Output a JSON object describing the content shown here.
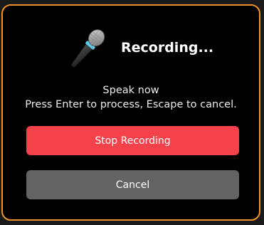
{
  "dialog": {
    "title": "Recording...",
    "icon": "microphone-icon",
    "message_line1": "Speak now",
    "message_line2": "Press Enter to process, Escape to cancel.",
    "stop_label": "Stop Recording",
    "cancel_label": "Cancel"
  },
  "colors": {
    "accent_border": "#f0922c",
    "stop_button": "#f5424a",
    "cancel_button": "#636363",
    "background": "#000000"
  }
}
